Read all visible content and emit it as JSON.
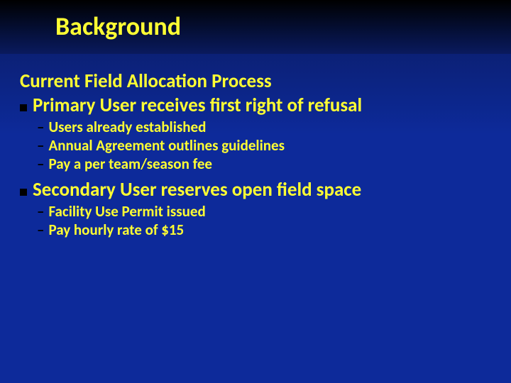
{
  "slide": {
    "title": "Background",
    "heading": "Current Field Allocation Process",
    "sections": [
      {
        "title": "Primary User receives first right of refusal",
        "items": [
          "Users already established",
          "Annual Agreement outlines guidelines",
          "Pay a per team/season fee"
        ]
      },
      {
        "title": "Secondary User reserves open field space",
        "items": [
          "Facility Use Permit issued",
          "Pay hourly rate of $15"
        ]
      }
    ]
  }
}
